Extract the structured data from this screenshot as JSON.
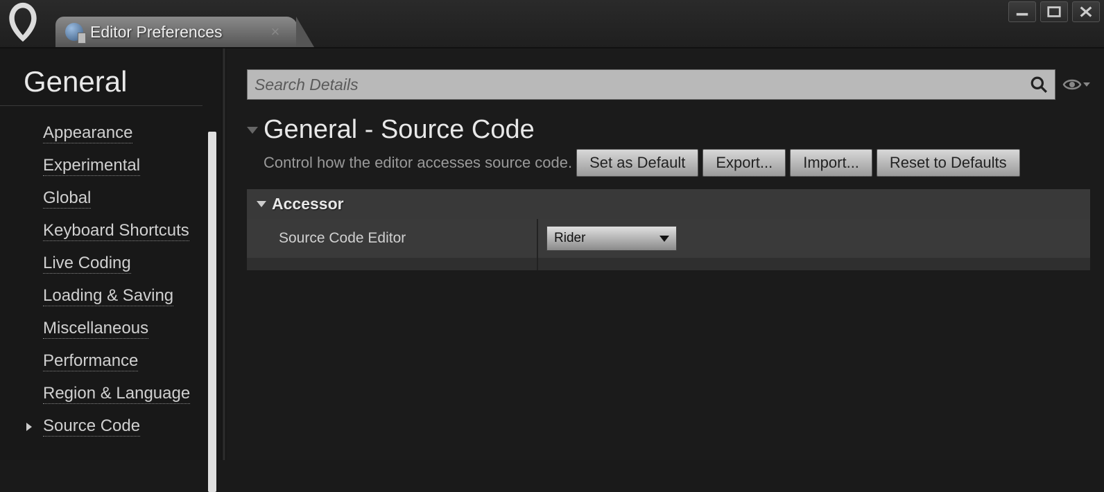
{
  "tab": {
    "title": "Editor Preferences"
  },
  "sidebar": {
    "category": "General",
    "items": [
      {
        "label": "Appearance",
        "active": false
      },
      {
        "label": "Experimental",
        "active": false
      },
      {
        "label": "Global",
        "active": false
      },
      {
        "label": "Keyboard Shortcuts",
        "active": false
      },
      {
        "label": "Live Coding",
        "active": false
      },
      {
        "label": "Loading & Saving",
        "active": false
      },
      {
        "label": "Miscellaneous",
        "active": false
      },
      {
        "label": "Performance",
        "active": false
      },
      {
        "label": "Region & Language",
        "active": false
      },
      {
        "label": "Source Code",
        "active": true
      }
    ]
  },
  "search": {
    "placeholder": "Search Details"
  },
  "panel": {
    "title": "General - Source Code",
    "description": "Control how the editor accesses source code.",
    "buttons": {
      "set_default": "Set as Default",
      "export": "Export...",
      "import": "Import...",
      "reset": "Reset to Defaults"
    }
  },
  "section": {
    "title": "Accessor",
    "property_label": "Source Code Editor",
    "property_value": "Rider"
  }
}
